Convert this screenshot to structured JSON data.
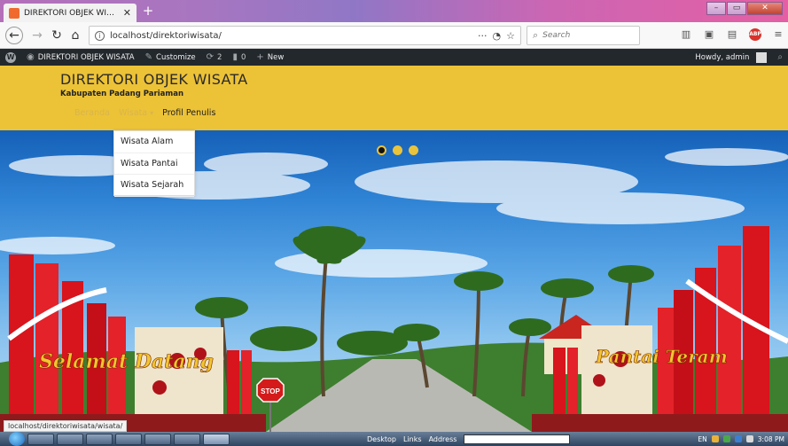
{
  "browser": {
    "tab_title": "DIREKTORI OBJEK WISATA – K",
    "url": "localhost/direktoriwisata/",
    "url_menu": "···",
    "search_placeholder": "Search",
    "status_url": "localhost/direktoriwisata/wisata/"
  },
  "adminbar": {
    "site_name": "DIREKTORI OBJEK WISATA",
    "customize": "Customize",
    "updates_count": "2",
    "comments_count": "0",
    "new": "New",
    "greeting": "Howdy, admin"
  },
  "site": {
    "title": "DIREKTORI OBJEK WISATA",
    "tagline": "Kabupaten Padang Pariaman"
  },
  "menu": {
    "items": [
      {
        "label": "Beranda"
      },
      {
        "label": "Wisata"
      },
      {
        "label": "Profil Penulis"
      }
    ],
    "dropdown": [
      "Wisata Alam",
      "Wisata Pantai",
      "Wisata Sejarah"
    ]
  },
  "slider": {
    "dots": 3,
    "active_index": 0,
    "sign_left": "Selamat Datang",
    "sign_right": "Pantai Teram",
    "stop_sign": "STOP"
  },
  "taskbar": {
    "desktop": "Desktop",
    "links": "Links",
    "address": "Address",
    "lang": "EN",
    "time": "3:08 PM"
  },
  "colors": {
    "header_yellow": "#ecc237",
    "adminbar": "#23282d",
    "gate_red": "#d8141c"
  }
}
